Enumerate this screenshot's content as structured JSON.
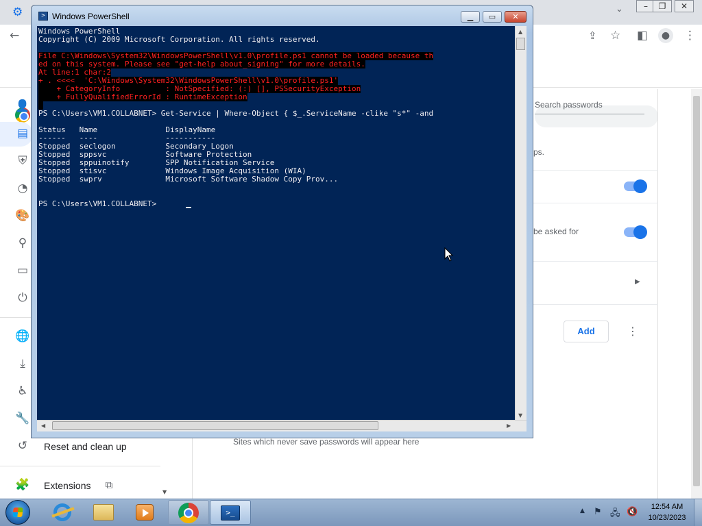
{
  "chrome": {
    "sidebar_items": [
      {
        "label": "",
        "icon": "person-icon"
      },
      {
        "label": "",
        "icon": "autofill-icon"
      },
      {
        "label": "",
        "icon": "shield-icon"
      },
      {
        "label": "",
        "icon": "gauge-icon"
      },
      {
        "label": "",
        "icon": "palette-icon"
      },
      {
        "label": "",
        "icon": "search-icon"
      },
      {
        "label": "",
        "icon": "browser-icon"
      },
      {
        "label": "",
        "icon": "power-icon"
      },
      {
        "label": "",
        "icon": "globe-icon"
      },
      {
        "label": "",
        "icon": "download-icon"
      },
      {
        "label": "",
        "icon": "accessibility-icon"
      },
      {
        "label": "",
        "icon": "wrench-icon"
      },
      {
        "label": "Reset and clean up",
        "icon": "reset-icon"
      },
      {
        "label": "Extensions",
        "icon": "puzzle-icon"
      }
    ],
    "search_passwords_placeholder": "Search passwords",
    "partial_text_1": "ps.",
    "partial_text_2": "be asked for",
    "add_button": "Add",
    "never_save_text": "Sites which never save passwords will appear here"
  },
  "powershell": {
    "title": "Windows PowerShell",
    "lines": [
      {
        "text": "Windows PowerShell",
        "type": "normal"
      },
      {
        "text": "Copyright (C) 2009 Microsoft Corporation. All rights reserved.",
        "type": "normal"
      },
      {
        "text": "",
        "type": "normal"
      },
      {
        "text": "File C:\\Windows\\System32\\WindowsPowerShell\\v1.0\\profile.ps1 cannot be loaded because th",
        "type": "error"
      },
      {
        "text": "ed on this system. Please see \"get-help about_signing\" for more details.",
        "type": "error"
      },
      {
        "text": "At line:1 char:2",
        "type": "error"
      },
      {
        "text": "+ . <<<<  'C:\\Windows\\System32\\WindowsPowerShell\\v1.0\\profile.ps1'",
        "type": "error"
      },
      {
        "text": "    + CategoryInfo          : NotSpecified: (:) [], PSSecurityException",
        "type": "error"
      },
      {
        "text": "    + FullyQualifiedErrorId : RuntimeException",
        "type": "error"
      },
      {
        "text": " ",
        "type": "error"
      },
      {
        "text": "PS C:\\Users\\VM1.COLLABNET> Get-Service | Where-Object { $_.ServiceName -clike \"s*\" -and",
        "type": "normal"
      },
      {
        "text": "",
        "type": "normal"
      },
      {
        "text": "Status   Name               DisplayName",
        "type": "normal"
      },
      {
        "text": "------   ----               -----------",
        "type": "normal"
      },
      {
        "text": "Stopped  seclogon           Secondary Logon",
        "type": "normal"
      },
      {
        "text": "Stopped  sppsvc             Software Protection",
        "type": "normal"
      },
      {
        "text": "Stopped  sppuinotify        SPP Notification Service",
        "type": "normal"
      },
      {
        "text": "Stopped  stisvc             Windows Image Acquisition (WIA)",
        "type": "normal"
      },
      {
        "text": "Stopped  swprv              Microsoft Software Shadow Copy Prov...",
        "type": "normal"
      },
      {
        "text": "",
        "type": "normal"
      },
      {
        "text": "",
        "type": "normal"
      },
      {
        "text": "PS C:\\Users\\VM1.COLLABNET> ",
        "type": "normal"
      }
    ]
  },
  "taskbar": {
    "apps": [
      {
        "name": "internet-explorer"
      },
      {
        "name": "file-explorer"
      },
      {
        "name": "media-player"
      },
      {
        "name": "google-chrome"
      },
      {
        "name": "windows-powershell"
      }
    ],
    "clock_time": "12:54 AM",
    "clock_date": "10/23/2023"
  },
  "colors": {
    "ps_background": "#012456",
    "ps_text": "#eeedf0",
    "ps_error": "#ff2121",
    "chrome_accent": "#1a73e8"
  }
}
